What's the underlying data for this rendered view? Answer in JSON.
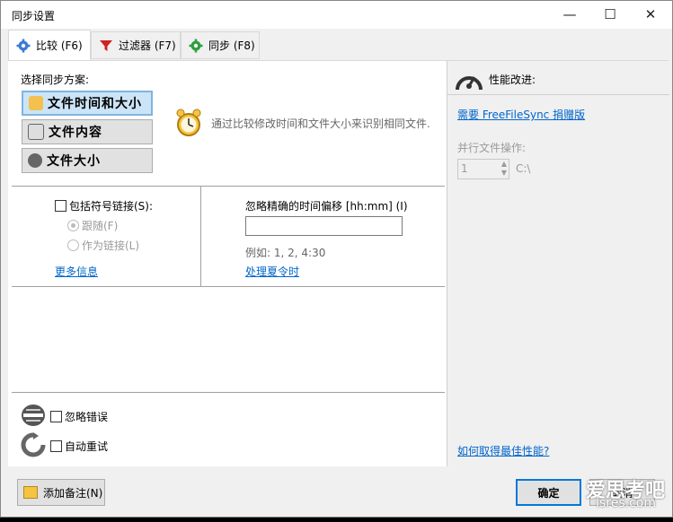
{
  "window": {
    "title": "同步设置",
    "minimize_glyph": "—",
    "maximize_glyph": "☐",
    "close_glyph": "✕"
  },
  "tabs": [
    {
      "label": "比较 (F6)",
      "icon": "gear-icon",
      "active": true
    },
    {
      "label": "过滤器 (F7)",
      "icon": "filter-icon",
      "active": false
    },
    {
      "label": "同步 (F8)",
      "icon": "sync-gear-icon",
      "active": false
    }
  ],
  "compare": {
    "header": "选择同步方案:",
    "variants": [
      {
        "label": "文件时间和大小",
        "icon": "clock-icon",
        "selected": true
      },
      {
        "label": "文件内容",
        "icon": "binary-file-icon",
        "selected": false
      },
      {
        "label": "文件大小",
        "icon": "file-size-icon",
        "selected": false
      }
    ],
    "description": "通过比较修改时间和文件大小来识别相同文件."
  },
  "symlinks": {
    "checkbox_label": "包括符号链接(S):",
    "radio_follow": "跟随(F)",
    "radio_as_link": "作为链接(L)",
    "more_info": "更多信息"
  },
  "time_shift": {
    "label": "忽略精确的时间偏移 [hh:mm] (I)",
    "value": "",
    "example": "例如: 1, 2, 4:30",
    "dst_link": "处理夏令时"
  },
  "errors": {
    "ignore_errors": "忽略错误",
    "auto_retry": "自动重试"
  },
  "performance": {
    "header": "性能改进:",
    "donate_link": "需要 FreeFileSync 捐赠版",
    "parallel_label": "并行文件操作:",
    "parallel_value": "1",
    "drive": "C:\\",
    "best_perf_link": "如何取得最佳性能?"
  },
  "bottom": {
    "add_note": "添加备注(N)",
    "ok": "确定",
    "cancel": "取消"
  },
  "watermark": {
    "line1": "爱思考吧",
    "line2": "isres.com"
  },
  "colors": {
    "accent": "#0078d7",
    "link": "#0066cc",
    "selected_bg": "#cce4f7"
  }
}
